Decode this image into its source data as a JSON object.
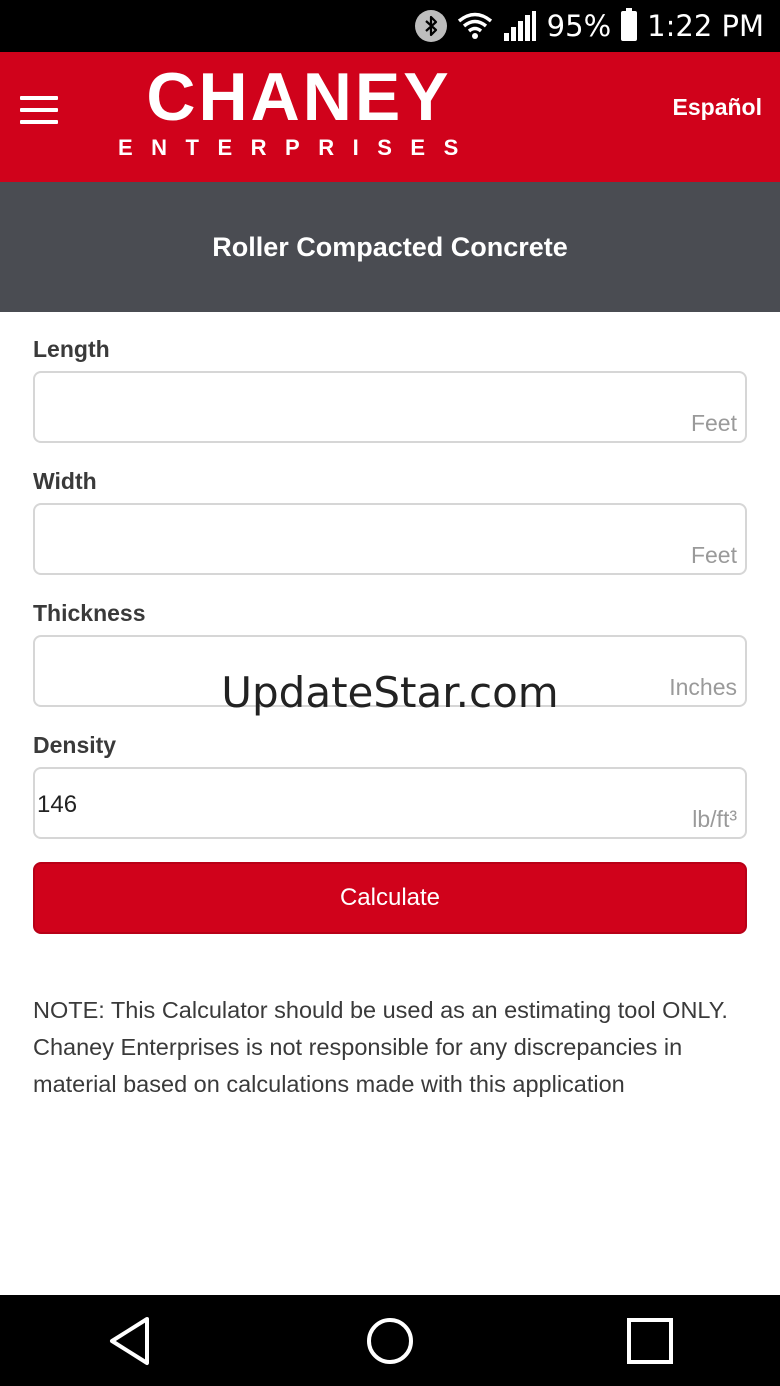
{
  "status": {
    "battery": "95%",
    "time": "1:22 PM"
  },
  "header": {
    "logo_main": "CHANEY",
    "logo_sub": "ENTERPRISES",
    "language_link": "Español"
  },
  "page": {
    "title": "Roller Compacted Concrete"
  },
  "form": {
    "fields": [
      {
        "label": "Length",
        "value": "",
        "unit": "Feet"
      },
      {
        "label": "Width",
        "value": "",
        "unit": "Feet"
      },
      {
        "label": "Thickness",
        "value": "",
        "unit": "Inches"
      },
      {
        "label": "Density",
        "value": "146",
        "unit": "lb/ft³"
      }
    ],
    "calculate_label": "Calculate"
  },
  "note": "NOTE: This Calculator should be used as an estimating tool ONLY. Chaney Enterprises is not responsible for any discrepancies in material based on calculations made with this application",
  "watermark": "UpdateStar.com",
  "colors": {
    "brand_red": "#d0021b",
    "title_bar": "#4a4c52"
  }
}
